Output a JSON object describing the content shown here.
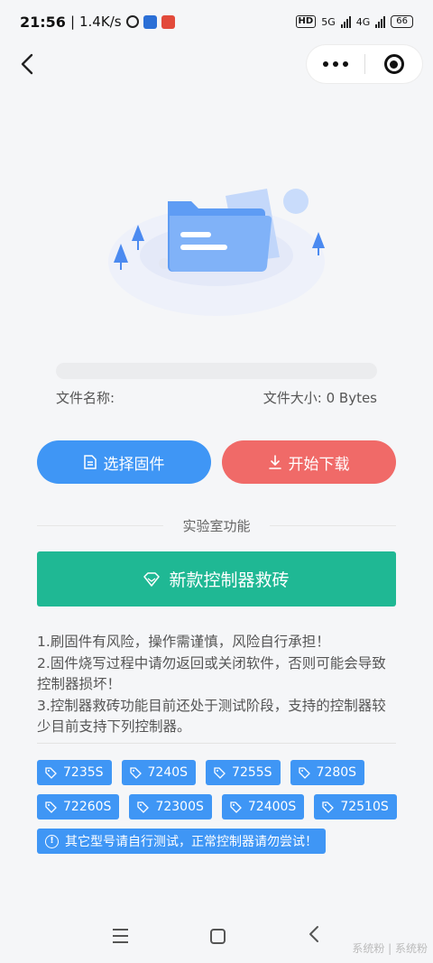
{
  "status_bar": {
    "time": "21:56",
    "speed": "1.4K/s",
    "network_hd": "HD",
    "net_5g": "5G",
    "net_4g": "4G",
    "battery": "66"
  },
  "file": {
    "name_label": "文件名称:",
    "size_label": "文件大小: 0 Bytes",
    "progress": 0
  },
  "buttons": {
    "select_firmware": "选择固件",
    "start_download": "开始下载",
    "rescue_controller": "新款控制器救砖"
  },
  "section": {
    "lab_title": "实验室功能"
  },
  "notes": [
    "1.刷固件有风险，操作需谨慎，风险自行承担！",
    "2.固件烧写过程中请勿返回或关闭软件，否则可能会导致控制器损坏！",
    "3.控制器救砖功能目前还处于测试阶段，支持的控制器较少目前支持下列控制器。"
  ],
  "models": [
    "7235S",
    "7240S",
    "7255S",
    "7280S",
    "72260S",
    "72300S",
    "72400S",
    "72510S"
  ],
  "warning_tag": "其它型号请自行测试，正常控制器请勿尝试！",
  "watermark": "系统粉 | 系统粉"
}
